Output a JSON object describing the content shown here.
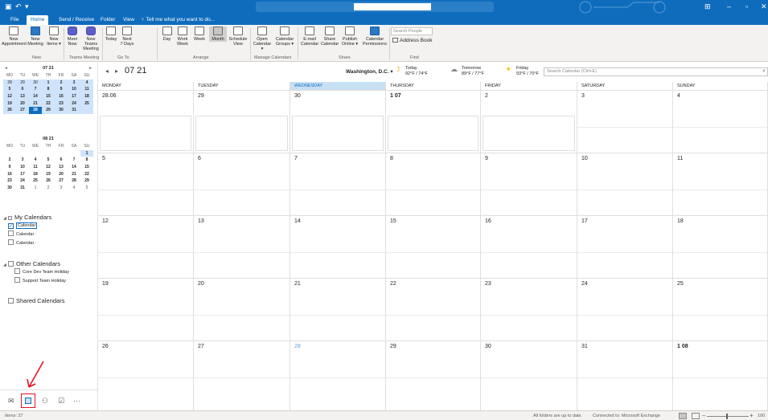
{
  "menu": {
    "tabs": [
      "File",
      "Home",
      "Send / Receive",
      "Folder",
      "View"
    ],
    "active": "Home",
    "tellme": "Tell me what you want to do..."
  },
  "ribbon": {
    "new": [
      {
        "line1": "New",
        "line2": "Appointment"
      },
      {
        "line1": "New",
        "line2": "Meeting"
      },
      {
        "line1": "New",
        "line2": "Items ▾"
      }
    ],
    "teams": [
      {
        "line1": "Meet",
        "line2": "Now"
      },
      {
        "line1": "New Teams",
        "line2": "Meeting"
      }
    ],
    "goto": [
      {
        "line1": "Today",
        "line2": ""
      },
      {
        "line1": "Next",
        "line2": "7 Days"
      }
    ],
    "arrange": [
      {
        "line1": "Day",
        "line2": ""
      },
      {
        "line1": "Work",
        "line2": "Week"
      },
      {
        "line1": "Week",
        "line2": ""
      },
      {
        "line1": "Month",
        "line2": ""
      },
      {
        "line1": "Schedule",
        "line2": "View"
      }
    ],
    "manage": [
      {
        "line1": "Open",
        "line2": "Calendar ▾"
      },
      {
        "line1": "Calendar",
        "line2": "Groups ▾"
      }
    ],
    "share": [
      {
        "line1": "E-mail",
        "line2": "Calendar"
      },
      {
        "line1": "Share",
        "line2": "Calendar"
      },
      {
        "line1": "Publish",
        "line2": "Online ▾"
      },
      {
        "line1": "Calendar",
        "line2": "Permissions"
      }
    ],
    "groups": {
      "new": "New",
      "teams": "Teams Meeting",
      "goto": "Go To",
      "arrange": "Arrange",
      "manage": "Manage Calendars",
      "share": "Share",
      "find": "Find"
    },
    "search_people_placeholder": "Search People",
    "address_book": "Address Book",
    "selected_view": "Month"
  },
  "minical1": {
    "title": "07 21",
    "days": [
      "MO",
      "TU",
      "WE",
      "TH",
      "FR",
      "SA",
      "SU"
    ],
    "weeks": [
      [
        "28",
        "29",
        "30",
        "1",
        "2",
        "3",
        "4"
      ],
      [
        "5",
        "6",
        "7",
        "8",
        "9",
        "10",
        "11"
      ],
      [
        "12",
        "13",
        "14",
        "15",
        "16",
        "17",
        "18"
      ],
      [
        "19",
        "20",
        "21",
        "22",
        "23",
        "24",
        "25"
      ],
      [
        "26",
        "27",
        "28",
        "29",
        "30",
        "31",
        ""
      ]
    ],
    "today": "28"
  },
  "minical2": {
    "title": "08 21",
    "days": [
      "MO",
      "TU",
      "WE",
      "TH",
      "FR",
      "SA",
      "SU"
    ],
    "weeks": [
      [
        "",
        "",
        "",
        "",
        "",
        "",
        "1"
      ],
      [
        "2",
        "3",
        "4",
        "5",
        "6",
        "7",
        "8"
      ],
      [
        "9",
        "10",
        "11",
        "12",
        "13",
        "14",
        "15"
      ],
      [
        "16",
        "17",
        "18",
        "19",
        "20",
        "21",
        "22"
      ],
      [
        "23",
        "24",
        "25",
        "26",
        "27",
        "28",
        "29"
      ],
      [
        "30",
        "31",
        "1",
        "2",
        "3",
        "4",
        "5"
      ]
    ]
  },
  "folders": {
    "my_calendars": "My Calendars",
    "my_items": [
      "Calendar",
      "Calendar",
      "Calendar"
    ],
    "other_calendars": "Other Calendars",
    "other_items": [
      "Core Dev Team Holiday",
      "Support Team Holiday"
    ],
    "shared_calendars": "Shared Calendars"
  },
  "bottom_nav": {
    "more": "···"
  },
  "calendar": {
    "title": "07 21",
    "location": "Washington, D.C. ▾",
    "weather": [
      {
        "day": "Today",
        "temp": "92°F / 74°F"
      },
      {
        "day": "Tomorrow",
        "temp": "89°F / 77°F"
      },
      {
        "day": "Friday",
        "temp": "93°F / 70°F"
      }
    ],
    "search_placeholder": "Search Calendar (Ctrl+E)",
    "day_headers": [
      "MONDAY",
      "TUESDAY",
      "WEDNESDAY",
      "THURSDAY",
      "FRIDAY",
      "SATURDAY",
      "SUNDAY"
    ],
    "weeks": [
      [
        "28.06",
        "29",
        "30",
        "1 07",
        "2",
        "3",
        "4"
      ],
      [
        "5",
        "6",
        "7",
        "8",
        "9",
        "10",
        "11"
      ],
      [
        "12",
        "13",
        "14",
        "15",
        "16",
        "17",
        "18"
      ],
      [
        "19",
        "20",
        "21",
        "22",
        "23",
        "24",
        "25"
      ],
      [
        "26",
        "27",
        "28",
        "29",
        "30",
        "31",
        "1 08"
      ]
    ],
    "today": "28"
  },
  "status": {
    "items": "Items: 27",
    "sync": "All folders are up to date.",
    "connection": "Connected to: Microsoft Exchange",
    "zoom": "100"
  },
  "colors": {
    "accent": "#0f6cbd",
    "today_header": "#c7e0f4",
    "annotation_red": "#e81123"
  }
}
